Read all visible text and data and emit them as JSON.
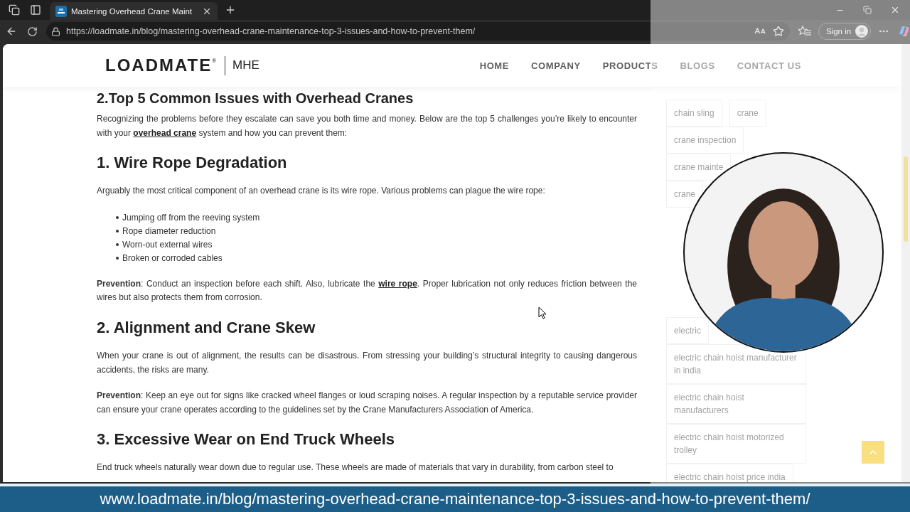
{
  "browser": {
    "tabs": [
      {
        "title": "Mastering Overhead Crane Maint",
        "selected": true
      }
    ],
    "address": "https://loadmate.in/blog/mastering-overhead-crane-maintenance-top-3-issues-and-how-to-prevent-them/",
    "sign_in": "Sign in"
  },
  "site_header": {
    "logo": {
      "brand": "LOADMATE",
      "registered": "®",
      "division": "MHE"
    },
    "nav": [
      "HOME",
      "COMPANY",
      "PRODUCTS",
      "BLOGS",
      "CONTACT US"
    ]
  },
  "article": {
    "blocks": [
      {
        "kind": "section_heading",
        "text": "2.Top 5 Common Issues with Overhead Cranes"
      },
      {
        "kind": "paragraph",
        "text": "Recognizing the problems before they escalate can save you both time and money. Below are the top 5 challenges you’re likely to encounter with your ",
        "link": "overhead crane",
        "after": " system and how you can prevent them:"
      },
      {
        "kind": "heading",
        "text": "1. Wire Rope Degradation"
      },
      {
        "kind": "paragraph",
        "text": "Arguably the most critical component of an overhead crane is its wire rope. Various problems can plague the wire rope:"
      },
      {
        "kind": "list",
        "items": [
          "Jumping off from the reeving system",
          "Rope diameter reduction",
          "Worn-out external wires",
          "Broken or corroded cables"
        ]
      },
      {
        "kind": "paragraph",
        "text": "**Prevention**: Conduct an inspection before each shift. Also, lubricate the ",
        "link": "wire rope",
        "after": ". Proper lubrication not only reduces friction between the wires but also protects them from corrosion."
      },
      {
        "kind": "heading",
        "text": "2. Alignment and Crane Skew"
      },
      {
        "kind": "paragraph",
        "text": "When your crane is out of alignment, the results can be disastrous. From stressing your building’s structural integrity to causing dangerous accidents, the risks are many."
      },
      {
        "kind": "paragraph",
        "text": "**Prevention**: Keep an eye out for signs like cracked wheel flanges or loud scraping noises. A regular inspection by a reputable service provider can ensure your crane operates according to the guidelines set by the Crane Manufacturers Association of America."
      },
      {
        "kind": "heading",
        "text": "3. Excessive Wear on End Truck Wheels"
      },
      {
        "kind": "paragraph",
        "text": "End truck wheels naturally wear down due to regular use. These wheels are made of materials that vary in durability, from carbon steel to"
      }
    ]
  },
  "sidebar": {
    "tag_rows": [
      [
        "chain sling",
        "crane"
      ],
      [
        "crane inspection"
      ],
      [
        "crane mainte"
      ],
      [
        "crane"
      ],
      [
        "electric"
      ],
      [
        "electric chain hoist manufacturer in india"
      ],
      [
        "electric chain hoist manufacturers"
      ],
      [
        "electric chain hoist motorized trolley"
      ],
      [
        "electric chain hoist price india"
      ]
    ]
  },
  "banner": {
    "text": "www.loadmate.in/blog/mastering-overhead-crane-maintenance-top-3-issues-and-how-to-prevent-them/"
  }
}
